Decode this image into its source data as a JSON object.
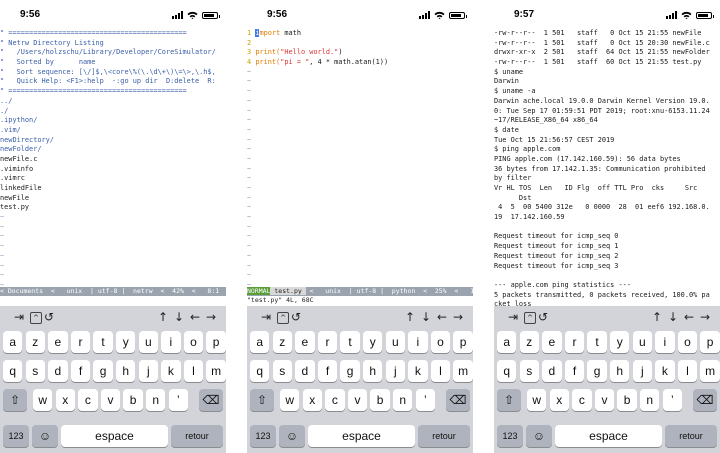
{
  "phones": [
    {
      "time": "9:56",
      "lines": [
        "\" ===========================================",
        "\" Netrw Directory Listing",
        "\"   /Users/holzschu/Library/Developer/CoreSimulator/",
        "\"   Sorted by      name",
        "\"   Sort sequence: [\\/]$,\\<core\\%(\\.\\d\\+\\)\\=\\>,\\.h$,",
        "\"   Quick Help: <F1>:help  -:go up dir  D:delete  R:",
        "\" ===========================================",
        "../",
        "./",
        ".ipython/",
        ".vim/",
        "newDirectory/",
        "newFolder/",
        "newFile.c",
        ".viminfo",
        ".vimrc",
        "linkedFile",
        "newFile",
        "test.py",
        "~",
        "~",
        "~",
        "~",
        "~",
        "~",
        "~",
        "~",
        "~",
        "~",
        "~",
        "~",
        "~",
        "~",
        "~"
      ],
      "status": "< Documents  <   unix  | utf-8 |  netrw  <  42%  <   8:1 ",
      "cmd": ""
    },
    {
      "time": "9:56",
      "code": [
        {
          "n": "1",
          "pre": "",
          "kw": "import",
          "post": " math"
        },
        {
          "n": "2",
          "pre": "",
          "kw": "",
          "post": ""
        },
        {
          "n": "3",
          "pre": "print(",
          "str": "\"Hello world.\"",
          "post": ")"
        },
        {
          "n": "4",
          "pre": "print(",
          "str": "\"pi = \"",
          "post": ", 4 * math.atan(1))"
        }
      ],
      "tildes": 23,
      "mode": "NORMAL",
      "fname": " test.py ",
      "status": " <   unix  | utf-8 |  python  <  25%  <   1:1 ",
      "cmd": "\"test.py\" 4L, 68C"
    },
    {
      "time": "9:57",
      "lines": [
        "-rw-r--r--  1 501   staff   0 Oct 15 21:55 newFile",
        "-rw-r--r--  1 501   staff   0 Oct 15 20:30 newFile.c",
        "drwxr-xr-x  2 501   staff  64 Oct 15 21:55 newFolder",
        "-rw-r--r--  1 501   staff  60 Oct 15 21:55 test.py",
        "$ uname",
        "Darwin",
        "$ uname -a",
        "Darwin ache.local 19.0.0 Darwin Kernel Version 19.0.",
        "0: Tue Sep 17 01:59:51 PDT 2019; root:xnu-6153.11.24",
        "~17/RELEASE_X86_64 x86_64",
        "$ date",
        "Tue Oct 15 21:56:57 CEST 2019",
        "$ ping apple.com",
        "PING apple.com (17.142.160.59): 56 data bytes",
        "36 bytes from 17.142.1.35: Communication prohibited",
        "by filter",
        "Vr HL TOS  Len   ID Flg  off TTL Pro  cks     Src",
        "      Dst",
        " 4  5  00 5400 312e   0 0000  28  01 eef6 192.168.0.",
        "19  17.142.160.59",
        "",
        "Request timeout for icmp_seq 0",
        "Request timeout for icmp_seq 1",
        "Request timeout for icmp_seq 2",
        "Request timeout for icmp_seq 3",
        "",
        "--- apple.com ping statistics ---",
        "5 packets transmitted, 0 packets received, 100.0% pa",
        "cket loss",
        "$"
      ]
    }
  ],
  "accessory": {
    "tab": "⇥",
    "ctrl": "^",
    "esc": "↺",
    "up": "↑",
    "down": "↓",
    "left": "←",
    "right": "→"
  },
  "keyboard": {
    "row1": [
      "a",
      "z",
      "e",
      "r",
      "t",
      "y",
      "u",
      "i",
      "o",
      "p"
    ],
    "row2": [
      "q",
      "s",
      "d",
      "f",
      "g",
      "h",
      "j",
      "k",
      "l",
      "m"
    ],
    "row3": [
      "w",
      "x",
      "c",
      "v",
      "b",
      "n",
      "’"
    ],
    "shift": "⇧",
    "backspace": "⌫",
    "numbers": "123",
    "emoji": "☺",
    "space": "espace",
    "return": "retour"
  }
}
